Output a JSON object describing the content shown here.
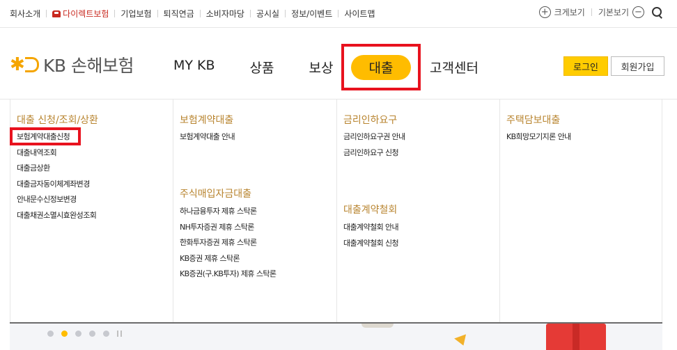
{
  "topbar": {
    "links": [
      "회사소개",
      "다이렉트보험",
      "기업보험",
      "퇴직연금",
      "소비자마당",
      "공시실",
      "정보/이벤트",
      "사이트맵"
    ],
    "zoom_in_label": "크게보기",
    "zoom_default_label": "기본보기"
  },
  "header": {
    "logo_text": "KB 손해보험",
    "gnb": [
      "MY KB",
      "상품",
      "보상",
      "대출",
      "고객센터"
    ],
    "active_item": "대출",
    "login_label": "로그인",
    "join_label": "회원가입"
  },
  "mega_menu": {
    "col1": {
      "title": "대출 신청/조회/상환",
      "items": [
        "보험계약대출신청",
        "대출내역조회",
        "대출금상환",
        "대출금자동이체계좌변경",
        "안내문수신정보변경",
        "대출채권소멸시효완성조회"
      ]
    },
    "col2": {
      "title": "보험계약대출",
      "items": [
        "보험계약대출 안내"
      ],
      "title2": "주식매입자금대출",
      "items2": [
        "하나금융투자 제휴 스탁론",
        "NH투자증권 제휴 스탁론",
        "한화투자증권 제휴 스탁론",
        "KB증권 제휴 스탁론",
        "KB증권(구.KB투자) 제휴 스탁론"
      ]
    },
    "col3": {
      "title": "금리인하요구",
      "items": [
        "금리인하요구권 안내",
        "금리인하요구 신청"
      ],
      "title2": "대출계약철회",
      "items2": [
        "대출계약철회 안내",
        "대출계약철회 신청"
      ]
    },
    "col4": {
      "title": "주택담보대출",
      "items": [
        "KB희망모기지론 안내"
      ]
    }
  },
  "colors": {
    "accent": "#ffbc00",
    "highlight": "#e8121e",
    "group_title": "#b8842f"
  },
  "icons": [
    "car-icon",
    "zoom-in-icon",
    "zoom-out-icon",
    "search-icon",
    "logo-icon",
    "pause-icon"
  ]
}
